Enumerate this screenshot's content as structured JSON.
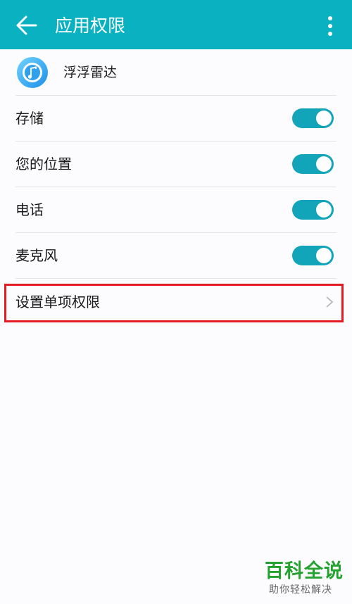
{
  "appbar": {
    "title": "应用权限"
  },
  "app": {
    "name": "浮浮雷达"
  },
  "permissions": [
    {
      "label": "存储",
      "enabled": true
    },
    {
      "label": "您的位置",
      "enabled": true
    },
    {
      "label": "电话",
      "enabled": true
    },
    {
      "label": "麦克风",
      "enabled": true
    }
  ],
  "single_permission": {
    "label": "设置单项权限"
  },
  "watermark": {
    "title": "百科全说",
    "subtitle": "助你轻松解决"
  },
  "colors": {
    "appbar": "#0ab1c1",
    "toggle_on": "#12a5b9",
    "highlight": "#e31b23",
    "watermark": "#23a22f"
  },
  "icons": {
    "back": "arrow-left-icon",
    "more": "more-vertical-icon",
    "app": "music-note-icon",
    "chevron": "chevron-right-icon"
  }
}
